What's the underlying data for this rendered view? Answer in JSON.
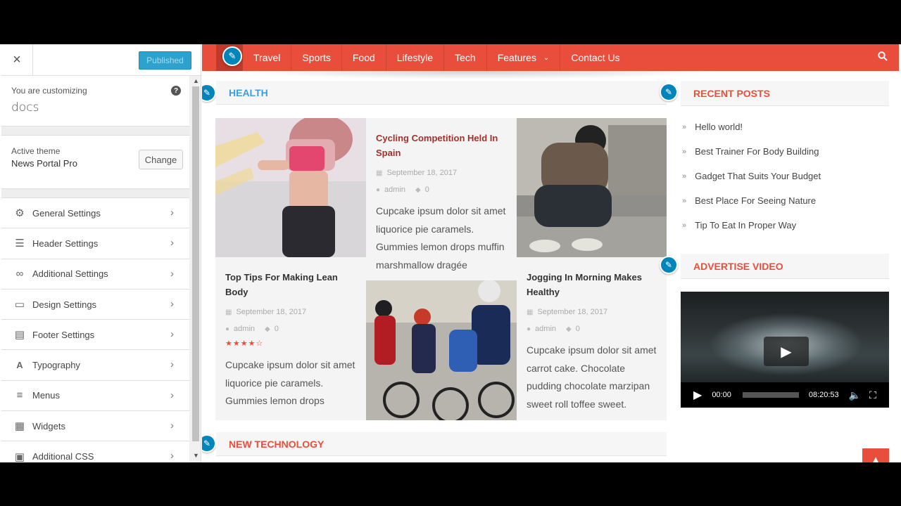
{
  "customizer": {
    "close_label": "×",
    "published_label": "Published",
    "customizing_label": "You are customizing",
    "site_name": "docs",
    "help_icon": "?",
    "active_theme_label": "Active theme",
    "theme_name": "News Portal Pro",
    "change_label": "Change",
    "items": [
      {
        "label": "General Settings",
        "icon": "gear-icon"
      },
      {
        "label": "Header Settings",
        "icon": "header-icon"
      },
      {
        "label": "Additional Settings",
        "icon": "link-icon"
      },
      {
        "label": "Design Settings",
        "icon": "monitor-icon"
      },
      {
        "label": "Footer Settings",
        "icon": "footer-icon"
      },
      {
        "label": "Typography",
        "icon": "typography-icon"
      },
      {
        "label": "Menus",
        "icon": "menu-icon"
      },
      {
        "label": "Widgets",
        "icon": "widgets-icon"
      },
      {
        "label": "Additional CSS",
        "icon": "css-icon"
      }
    ]
  },
  "nav": {
    "items": [
      "Travel",
      "Sports",
      "Food",
      "Lifestyle",
      "Tech",
      "Features",
      "Contact Us"
    ]
  },
  "health": {
    "title": "HEALTH",
    "posts": [
      {
        "title": "Top Tips For Making Lean Body",
        "date": "September 18, 2017",
        "author": "admin",
        "comments": "0",
        "rating": 4,
        "excerpt": "Cupcake ipsum dolor sit amet liquorice pie caramels. Gummies lemon drops"
      },
      {
        "title": "Cycling Competition Held In Spain",
        "date": "September 18, 2017",
        "author": "admin",
        "comments": "0",
        "excerpt": "Cupcake ipsum dolor sit amet liquorice pie caramels. Gummies lemon drops muffin marshmallow dragée"
      },
      {
        "title": "Jogging In Morning Makes Healthy",
        "date": "September 18, 2017",
        "author": "admin",
        "comments": "0",
        "excerpt": "Cupcake ipsum dolor sit amet carrot cake. Chocolate pudding chocolate marzipan sweet roll toffee sweet."
      }
    ]
  },
  "recent_posts": {
    "title": "RECENT POSTS",
    "items": [
      "Hello world!",
      "Best Trainer For Body Building",
      "Gadget That Suits Your Budget",
      "Best Place For Seeing Nature",
      "Tip To Eat In Proper Way"
    ]
  },
  "video": {
    "title": "ADVERTISE VIDEO",
    "current_time": "00:00",
    "duration": "08:20:53"
  },
  "tech": {
    "title": "NEW TECHNOLOGY"
  },
  "colors": {
    "accent": "#e94e3c",
    "customizer_blue": "#0085ba",
    "health_blue": "#3c9de0"
  }
}
